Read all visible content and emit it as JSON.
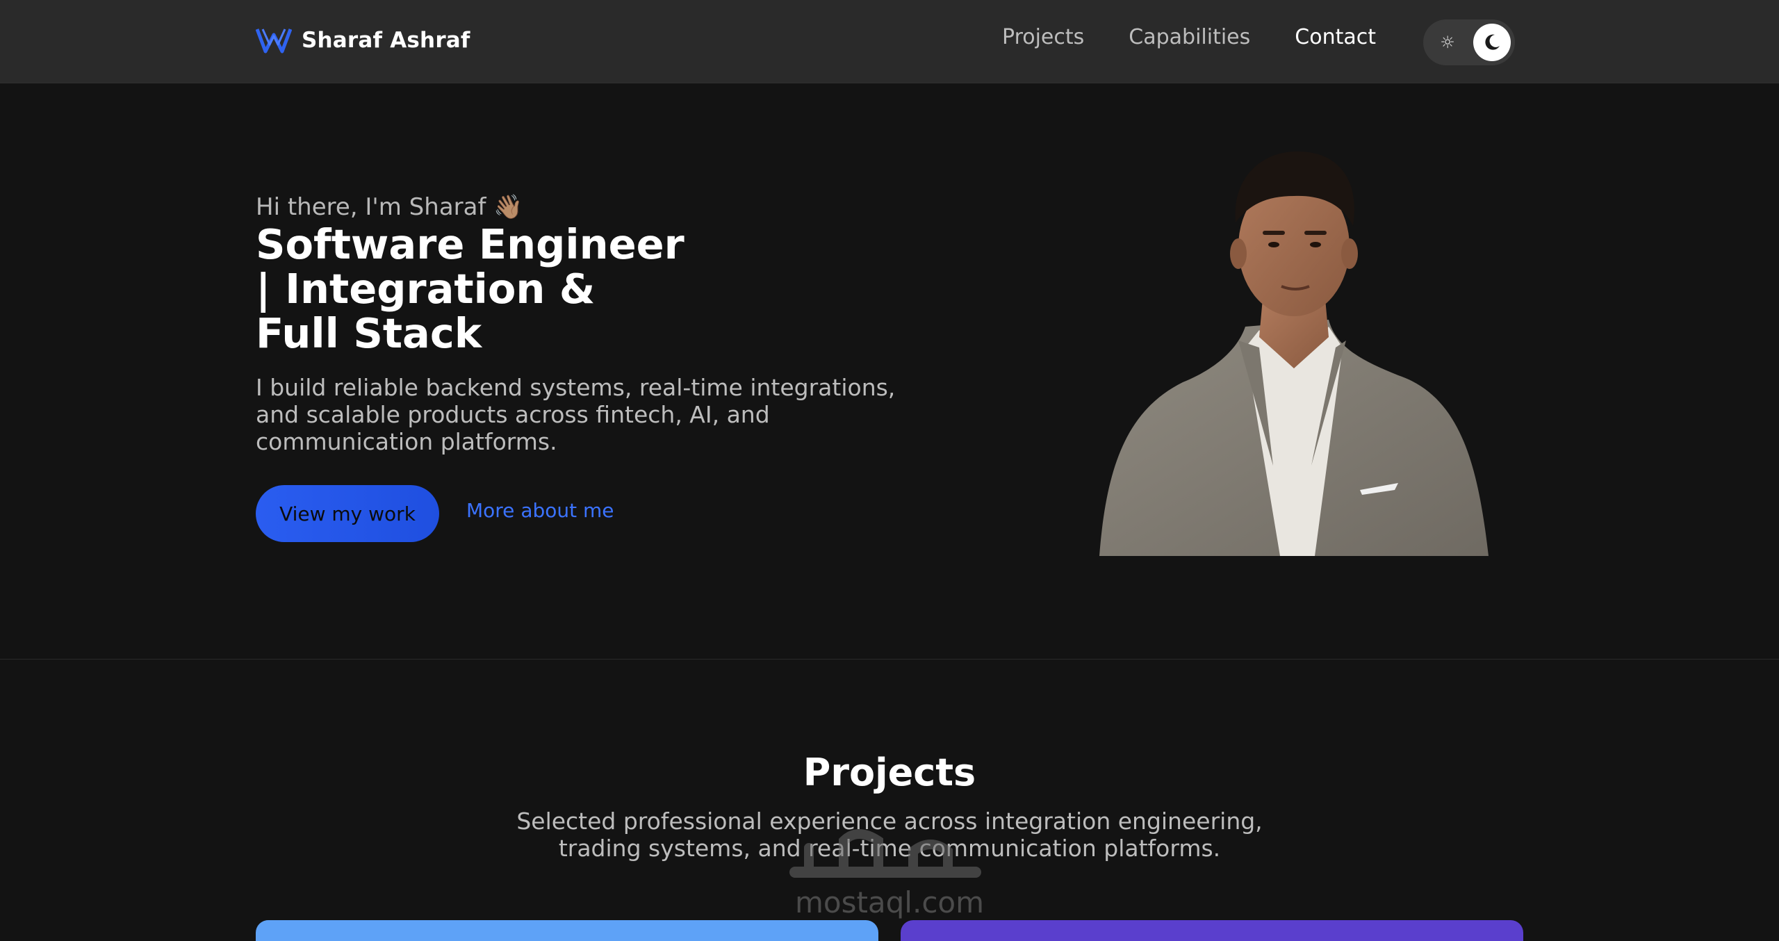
{
  "header": {
    "brand_name": "Sharaf Ashraf",
    "nav": [
      {
        "label": "Projects",
        "active": false
      },
      {
        "label": "Capabilities",
        "active": false
      },
      {
        "label": "Contact",
        "active": true
      }
    ],
    "theme_toggle": {
      "light_icon": "sun-icon",
      "dark_icon": "moon-icon",
      "selected": "dark"
    }
  },
  "hero": {
    "greeting": "Hi there, I'm Sharaf 👋🏽",
    "title": "Software Engineer | Integration & Full Stack",
    "description": "I build reliable backend systems, real-time integrations, and scalable products across fintech, AI, and communication platforms.",
    "primary_cta": "View my work",
    "secondary_cta": "More about me"
  },
  "projects": {
    "title": "Projects",
    "description": "Selected professional experience across integration engineering, trading systems, and real-time communication platforms."
  },
  "watermark": {
    "arabic": "مستقل",
    "latin": "mostaql.com"
  },
  "colors": {
    "background": "#131313",
    "header": "#2a2a2a",
    "accent": "#2a5df0",
    "link": "#3b73ff",
    "card_blue": "#5ea2f7",
    "card_purple": "#5a3fcd"
  }
}
